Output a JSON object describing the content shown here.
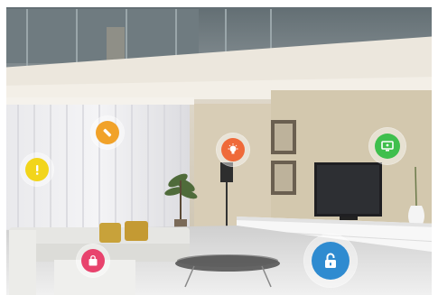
{
  "colors": {
    "alert": "#f2d51b",
    "pen": "#f1a229",
    "bulb": "#ef6a3a",
    "monitor": "#3fbf4d",
    "bag": "#e8436d",
    "lock": "#2f8bd0"
  },
  "icons": [
    "alert-icon",
    "pen-icon",
    "bulb-icon",
    "monitor-icon",
    "shopping-bag-icon",
    "lock-icon"
  ]
}
